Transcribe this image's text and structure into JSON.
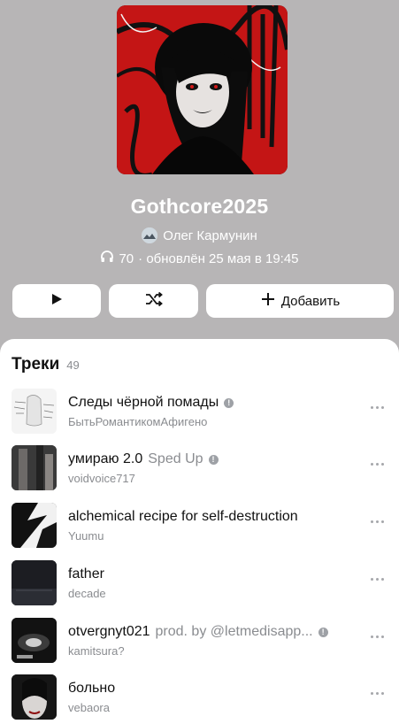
{
  "playlist": {
    "title": "Gothcore2025",
    "author": "Олег Кармунин",
    "listens": "70",
    "updated": "· обновлён 25 мая в 19:45"
  },
  "buttons": {
    "add_label": "Добавить"
  },
  "tracks_section": {
    "title": "Треки",
    "count": "49"
  },
  "tracks": [
    {
      "title": "Следы чёрной помады",
      "subtitle": "",
      "artist": "БытьРомантикомАфигено",
      "explicit": true
    },
    {
      "title": "умираю 2.0",
      "subtitle": "Sped Up",
      "artist": "voidvoice717",
      "explicit": true
    },
    {
      "title": "alchemical recipe for self-destruction",
      "subtitle": "",
      "artist": "Yuumu",
      "explicit": false
    },
    {
      "title": "father",
      "subtitle": "",
      "artist": "decade",
      "explicit": false
    },
    {
      "title": "otvergnyt021",
      "subtitle": "prod. by @letmedisapp...",
      "artist": "kamitsura?",
      "explicit": true
    },
    {
      "title": "больно",
      "subtitle": "",
      "artist": "vebaora",
      "explicit": false
    }
  ],
  "icons": {
    "listens": "headphones-icon",
    "play": "play-icon",
    "shuffle": "shuffle-icon",
    "add": "plus-icon",
    "info": "info-icon",
    "more": "more-dots-icon"
  },
  "colors": {
    "header_bg": "#b7b5b6",
    "accent_red": "#d21a1a"
  }
}
